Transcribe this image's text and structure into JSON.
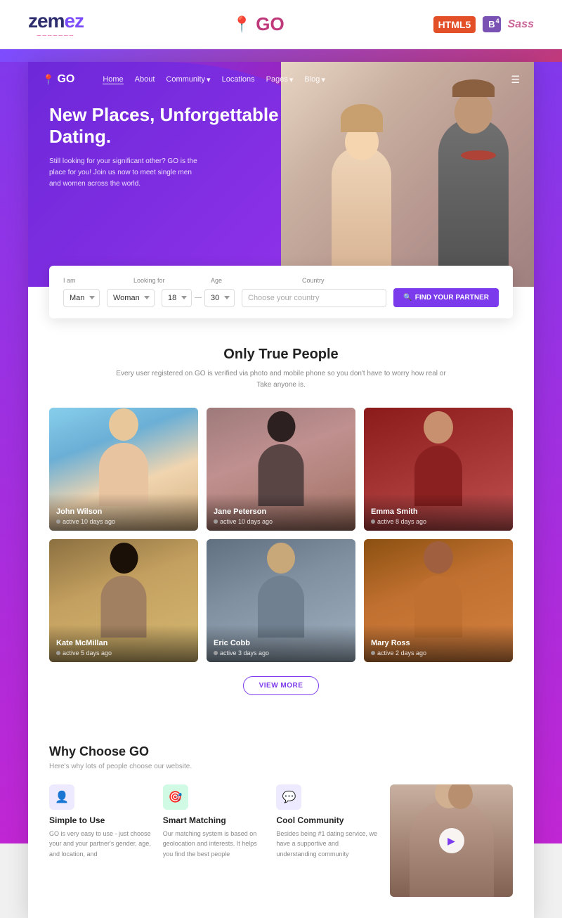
{
  "top_header": {
    "logo_zemes": "zem",
    "logo_zemes_styled": "ez",
    "logo_go": "GO",
    "badge_html5": "HTML5",
    "badge_b4": "B",
    "badge_b4_sup": "4",
    "badge_sass": "Sass"
  },
  "site_nav": {
    "logo": "GO",
    "items": [
      {
        "label": "Home",
        "active": true
      },
      {
        "label": "About",
        "active": false
      },
      {
        "label": "Community",
        "active": false,
        "has_dropdown": true
      },
      {
        "label": "Locations",
        "active": false
      },
      {
        "label": "Pages",
        "active": false,
        "has_dropdown": true
      },
      {
        "label": "Blog",
        "active": false,
        "has_dropdown": true
      }
    ]
  },
  "hero": {
    "title": "New Places, Unforgettable Dating.",
    "description": "Still looking for your significant other? GO is the place for you! Join us now to meet single men and women across the world."
  },
  "search_bar": {
    "labels": {
      "i_am": "I am",
      "looking_for": "Looking for",
      "age": "Age",
      "country": "Country"
    },
    "i_am_value": "Man",
    "looking_for_value": "Woman",
    "age_min": "18",
    "age_max": "30",
    "country_placeholder": "Choose your country",
    "find_button": "FIND YOUR PARTNER"
  },
  "people_section": {
    "title": "Only True People",
    "subtitle": "Every user registered on GO is verified via photo and mobile phone so you don't have to worry how real or\nTake anyone is.",
    "people": [
      {
        "name": "John Wilson",
        "status": "active 10 days ago",
        "bg": "1"
      },
      {
        "name": "Jane Peterson",
        "status": "active 10 days ago",
        "bg": "2"
      },
      {
        "name": "Emma Smith",
        "status": "active 8 days ago",
        "bg": "3"
      },
      {
        "name": "Kate McMillan",
        "status": "active 5 days ago",
        "bg": "4"
      },
      {
        "name": "Eric Cobb",
        "status": "active 3 days ago",
        "bg": "5"
      },
      {
        "name": "Mary Ross",
        "status": "active 2 days ago",
        "bg": "6"
      }
    ],
    "view_more_label": "VIEW MORE"
  },
  "why_section": {
    "title": "Why Choose GO",
    "subtitle": "Here's why lots of people choose our website.",
    "items": [
      {
        "icon": "👤",
        "title": "Simple to Use",
        "description": "GO is very easy to use - just choose your and your partner's gender, age, and location, and"
      },
      {
        "icon": "🎯",
        "title": "Smart Matching",
        "description": "Our matching system is based on geolocation and interests. It helps you find the best people"
      },
      {
        "icon": "💬",
        "title": "Cool Community",
        "description": "Besides being #1 dating service, we have a supportive and understanding community"
      }
    ]
  }
}
